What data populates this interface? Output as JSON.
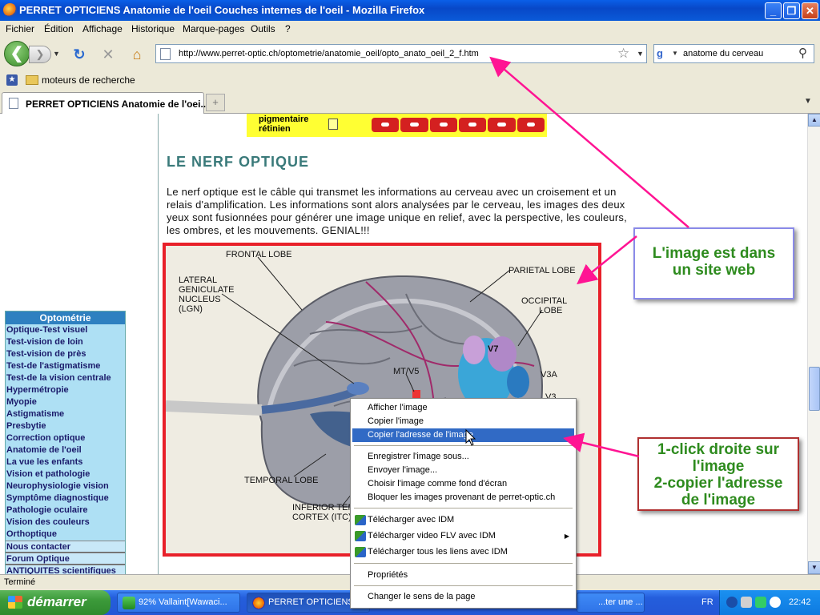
{
  "window": {
    "title": "PERRET OPTICIENS Anatomie de l'oeil Couches internes de l'oeil - Mozilla Firefox"
  },
  "menubar": [
    "Fichier",
    "Édition",
    "Affichage",
    "Historique",
    "Marque-pages",
    "Outils",
    "?"
  ],
  "navbar": {
    "url": "http://www.perret-optic.ch/optometrie/anatomie_oeil/opto_anato_oeil_2_f.htm",
    "search_value": "anatome du cerveau"
  },
  "bookmarks": {
    "folder_label": "moteurs de recherche"
  },
  "tabs": [
    {
      "label": "PERRET OPTICIENS Anatomie de l'oei..."
    }
  ],
  "page": {
    "pigment_label": "pigmentaire\nrétinien",
    "section_title": "LE NERF OPTIQUE",
    "paragraph": "Le nerf optique est le câble qui transmet les informations au cerveau avec un croisement et un relais d'amplification. Les informations sont alors analysées par le cerveau, les images des deux yeux sont fusionnées pour générer une image unique en relief, avec la perspective, les couleurs, les ombres, et les mouvements. GENIAL!!!",
    "brain_labels": {
      "frontal": "FRONTAL LOBE",
      "lgn": "LATERAL\nGENICULATE\nNUCLEUS\n(LGN)",
      "parietal": "PARIETAL LOBE",
      "occipital": "OCCIPITAL\nLOBE",
      "v7": "V7",
      "v3a": "V3A",
      "v3": "V3",
      "mtv5": "MT/V5",
      "temporal": "TEMPORAL LOBE",
      "itc": "INFERIOR TEMP\nCORTEX (ITC)"
    }
  },
  "sidebar": {
    "header": "Optométrie",
    "items": [
      "Optique-Test visuel",
      "Test-vision de loin",
      "Test-vision de près",
      "Test-de l'astigmatisme",
      "Test-de la vision centrale",
      "Hypermétropie",
      "Myopie",
      "Astigmatisme",
      "Presbytie",
      "Correction optique",
      "Anatomie de l'oeil",
      "La vue les enfants",
      "Vision et pathologie",
      "Neurophysiologie vision",
      "Symptôme diagnostique",
      "Pathologie oculaire",
      "Vision des couleurs",
      "Orthoptique"
    ],
    "extra_items": [
      "Nous contacter",
      "Forum Optique",
      "ANTIQUITES scientifiques"
    ]
  },
  "context_menu": {
    "items": [
      {
        "label": "Afficher l'image"
      },
      {
        "label": "Copier l'image"
      },
      {
        "label": "Copier l'adresse de l'image",
        "highlighted": true
      },
      {
        "label": "Enregistrer l'image sous..."
      },
      {
        "label": "Envoyer l'image..."
      },
      {
        "label": "Choisir l'image comme fond d'écran"
      },
      {
        "label": "Bloquer les images provenant de perret-optic.ch"
      },
      {
        "label": "Télécharger avec IDM"
      },
      {
        "label": "Télécharger video FLV avec IDM"
      },
      {
        "label": "Télécharger tous les liens avec IDM"
      },
      {
        "label": "Propriétés"
      },
      {
        "label": "Changer le sens de la page"
      }
    ]
  },
  "callouts": {
    "first": "L'image est dans\nun site web",
    "second": "1-click droite sur\nl'image\n2-copier l'adresse\nde l'image"
  },
  "status": {
    "text": "Terminé"
  },
  "taskbar": {
    "start": "démarrer",
    "tasks": [
      "92% Vallaint[Wawaci...",
      "PERRET OPTICIENS ...",
      "...ter une ..."
    ],
    "lang": "FR",
    "clock": "22:42"
  },
  "colors": {
    "annotation_arrow": "#FF1493",
    "callout_text": "#2E8B1E",
    "image_frame": "#E8202A",
    "section_title": "#3A7A7A",
    "menu_highlight": "#316AC5"
  }
}
